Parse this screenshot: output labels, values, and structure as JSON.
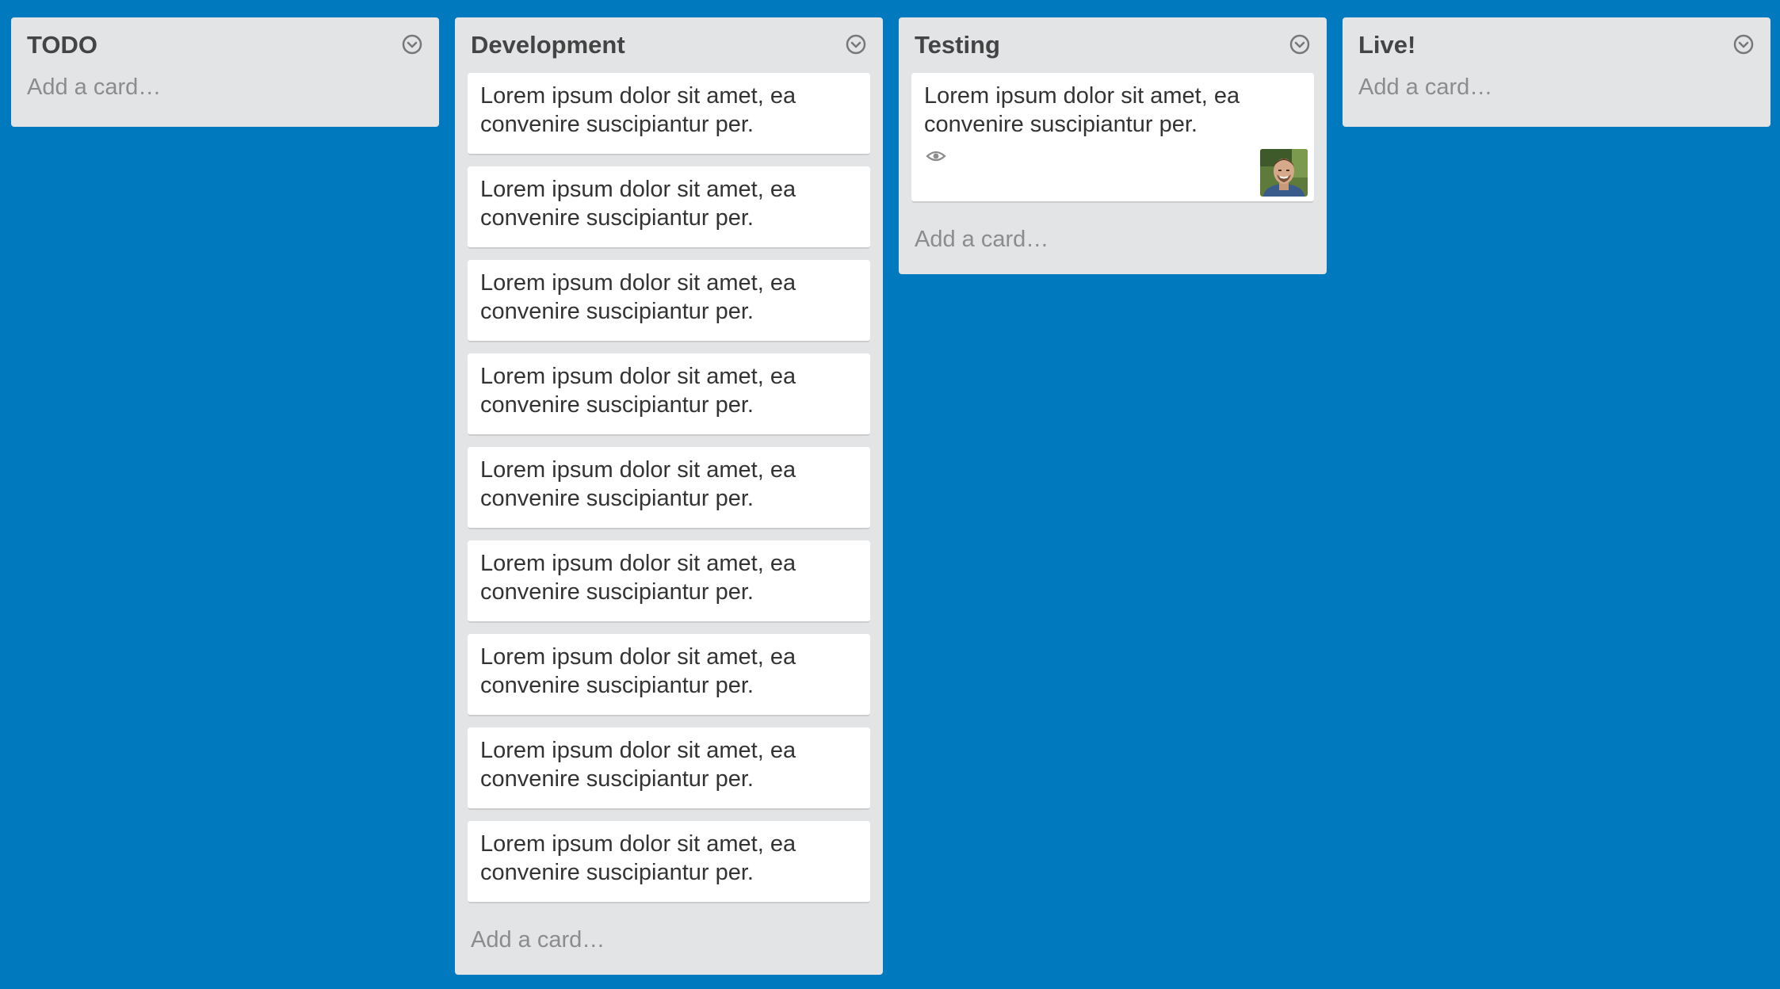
{
  "lists": [
    {
      "title": "TODO",
      "add_card_label": "Add a card…",
      "cards": []
    },
    {
      "title": "Development",
      "add_card_label": "Add a card…",
      "cards": [
        {
          "text": "Lorem ipsum dolor sit amet, ea convenire suscipiantur per."
        },
        {
          "text": "Lorem ipsum dolor sit amet, ea convenire suscipiantur per."
        },
        {
          "text": "Lorem ipsum dolor sit amet, ea convenire suscipiantur per."
        },
        {
          "text": "Lorem ipsum dolor sit amet, ea convenire suscipiantur per."
        },
        {
          "text": "Lorem ipsum dolor sit amet, ea convenire suscipiantur per."
        },
        {
          "text": "Lorem ipsum dolor sit amet, ea convenire suscipiantur per."
        },
        {
          "text": "Lorem ipsum dolor sit amet, ea convenire suscipiantur per."
        },
        {
          "text": "Lorem ipsum dolor sit amet, ea convenire suscipiantur per."
        },
        {
          "text": "Lorem ipsum dolor sit amet, ea convenire suscipiantur per."
        }
      ]
    },
    {
      "title": "Testing",
      "add_card_label": "Add a card…",
      "cards": [
        {
          "text": "Lorem ipsum dolor sit amet, ea convenire suscipiantur per.",
          "badge_icon": "eye-icon",
          "member": "member-avatar"
        }
      ]
    },
    {
      "title": "Live!",
      "add_card_label": "Add a card…",
      "cards": []
    }
  ],
  "icons": {
    "list_menu": "chevron-down-circle-icon",
    "watch": "eye-icon"
  },
  "colors": {
    "board_background": "#0079BF",
    "list_background": "#E2E4E6",
    "card_background": "#FFFFFF",
    "add_card_text": "#8C8C8C"
  }
}
